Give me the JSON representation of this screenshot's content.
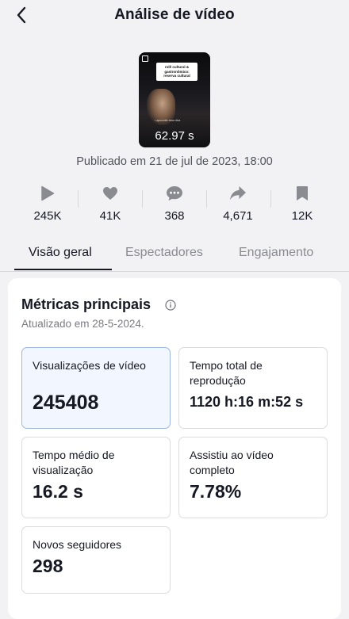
{
  "header": {
    "title": "Análise de vídeo"
  },
  "video": {
    "duration": "62.97 s",
    "tag_text": "rolê cultural & gastronômico: reserva cultural",
    "caption": "• aproveite essa dica"
  },
  "published": "Publicado em 21 de jul de 2023, 18:00",
  "stats": [
    {
      "icon": "play-icon",
      "value": "245K"
    },
    {
      "icon": "heart-icon",
      "value": "41K"
    },
    {
      "icon": "comment-icon",
      "value": "368"
    },
    {
      "icon": "share-icon",
      "value": "4,671"
    },
    {
      "icon": "bookmark-icon",
      "value": "12K"
    }
  ],
  "tabs": [
    {
      "label": "Visão geral"
    },
    {
      "label": "Espectadores"
    },
    {
      "label": "Engajamento"
    }
  ],
  "metrics_section": {
    "title": "Métricas principais",
    "updated": "Atualizado em 28-5-2024.",
    "metrics": [
      {
        "label": "Visualizações de vídeo",
        "value": "245408"
      },
      {
        "label": "Tempo total de reprodução",
        "value": "1120 h:16 m:52 s"
      },
      {
        "label": "Tempo médio de visualização",
        "value": "16.2 s"
      },
      {
        "label": "Assistiu ao vídeo completo",
        "value": "7.78%"
      },
      {
        "label": "Novos seguidores",
        "value": "298"
      }
    ]
  },
  "colors": {
    "text": "#161823",
    "muted": "#8a8b91",
    "selected_card": "#f2f6fe",
    "icon_gray": "#8a8b91"
  }
}
